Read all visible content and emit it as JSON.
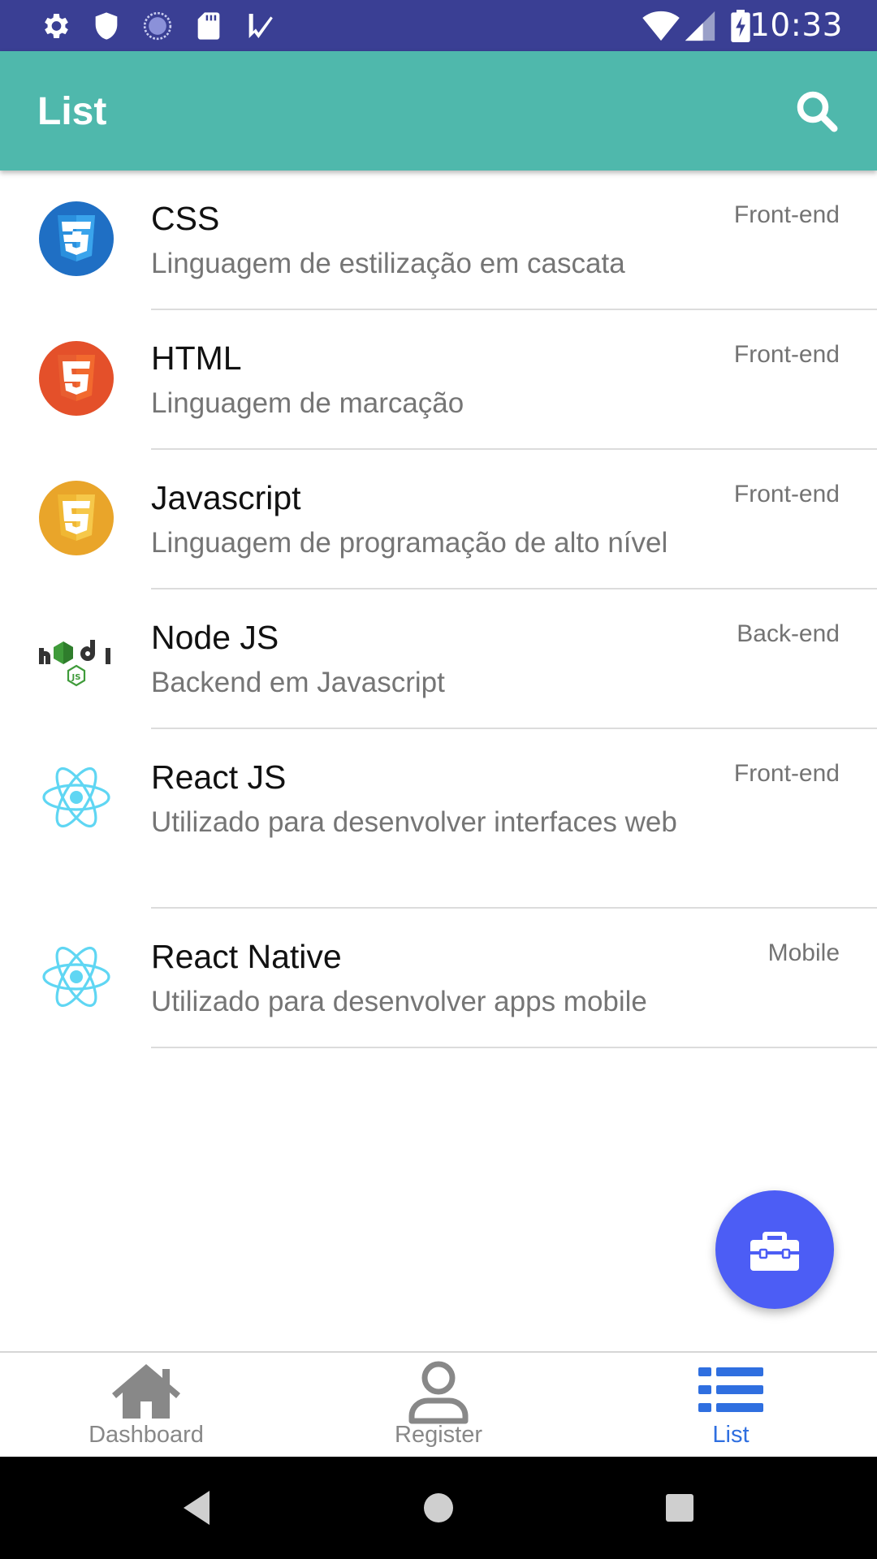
{
  "status_bar": {
    "time": "10:33",
    "left_icons": [
      "gear-icon",
      "shield-icon",
      "sync-icon",
      "sd-card-icon",
      "task-check-icon"
    ],
    "right_icons": [
      "wifi-icon",
      "cell-signal-icon",
      "battery-charging-icon"
    ]
  },
  "app_bar": {
    "title": "List",
    "search_icon": "search-icon",
    "color": "#4fb8ac"
  },
  "items": [
    {
      "title": "CSS",
      "subtitle": "Linguagem de estilização em cascata",
      "tag": "Front-end",
      "logo": "css3-logo"
    },
    {
      "title": "HTML",
      "subtitle": "Linguagem de marcação",
      "tag": "Front-end",
      "logo": "html5-logo"
    },
    {
      "title": "Javascript",
      "subtitle": "Linguagem de programação de alto nível",
      "tag": "Front-end",
      "logo": "javascript-logo"
    },
    {
      "title": "Node JS",
      "subtitle": "Backend em Javascript",
      "tag": "Back-end",
      "logo": "nodejs-logo"
    },
    {
      "title": "React JS",
      "subtitle": "Utilizado para desenvolver interfaces web",
      "tag": "Front-end",
      "logo": "react-logo"
    },
    {
      "title": "React Native",
      "subtitle": "Utilizado para desenvolver apps mobile",
      "tag": "Mobile",
      "logo": "react-logo"
    }
  ],
  "fab": {
    "icon": "toolbox-icon",
    "color": "#4c5df5"
  },
  "tabs": [
    {
      "label": "Dashboard",
      "icon": "home-icon",
      "active": false
    },
    {
      "label": "Register",
      "icon": "user-icon",
      "active": false
    },
    {
      "label": "List",
      "icon": "list-icon",
      "active": true
    }
  ],
  "colors": {
    "status_bar": "#3a3f94",
    "active_tab": "#2f6fe0",
    "inactive_tab": "#888888"
  }
}
